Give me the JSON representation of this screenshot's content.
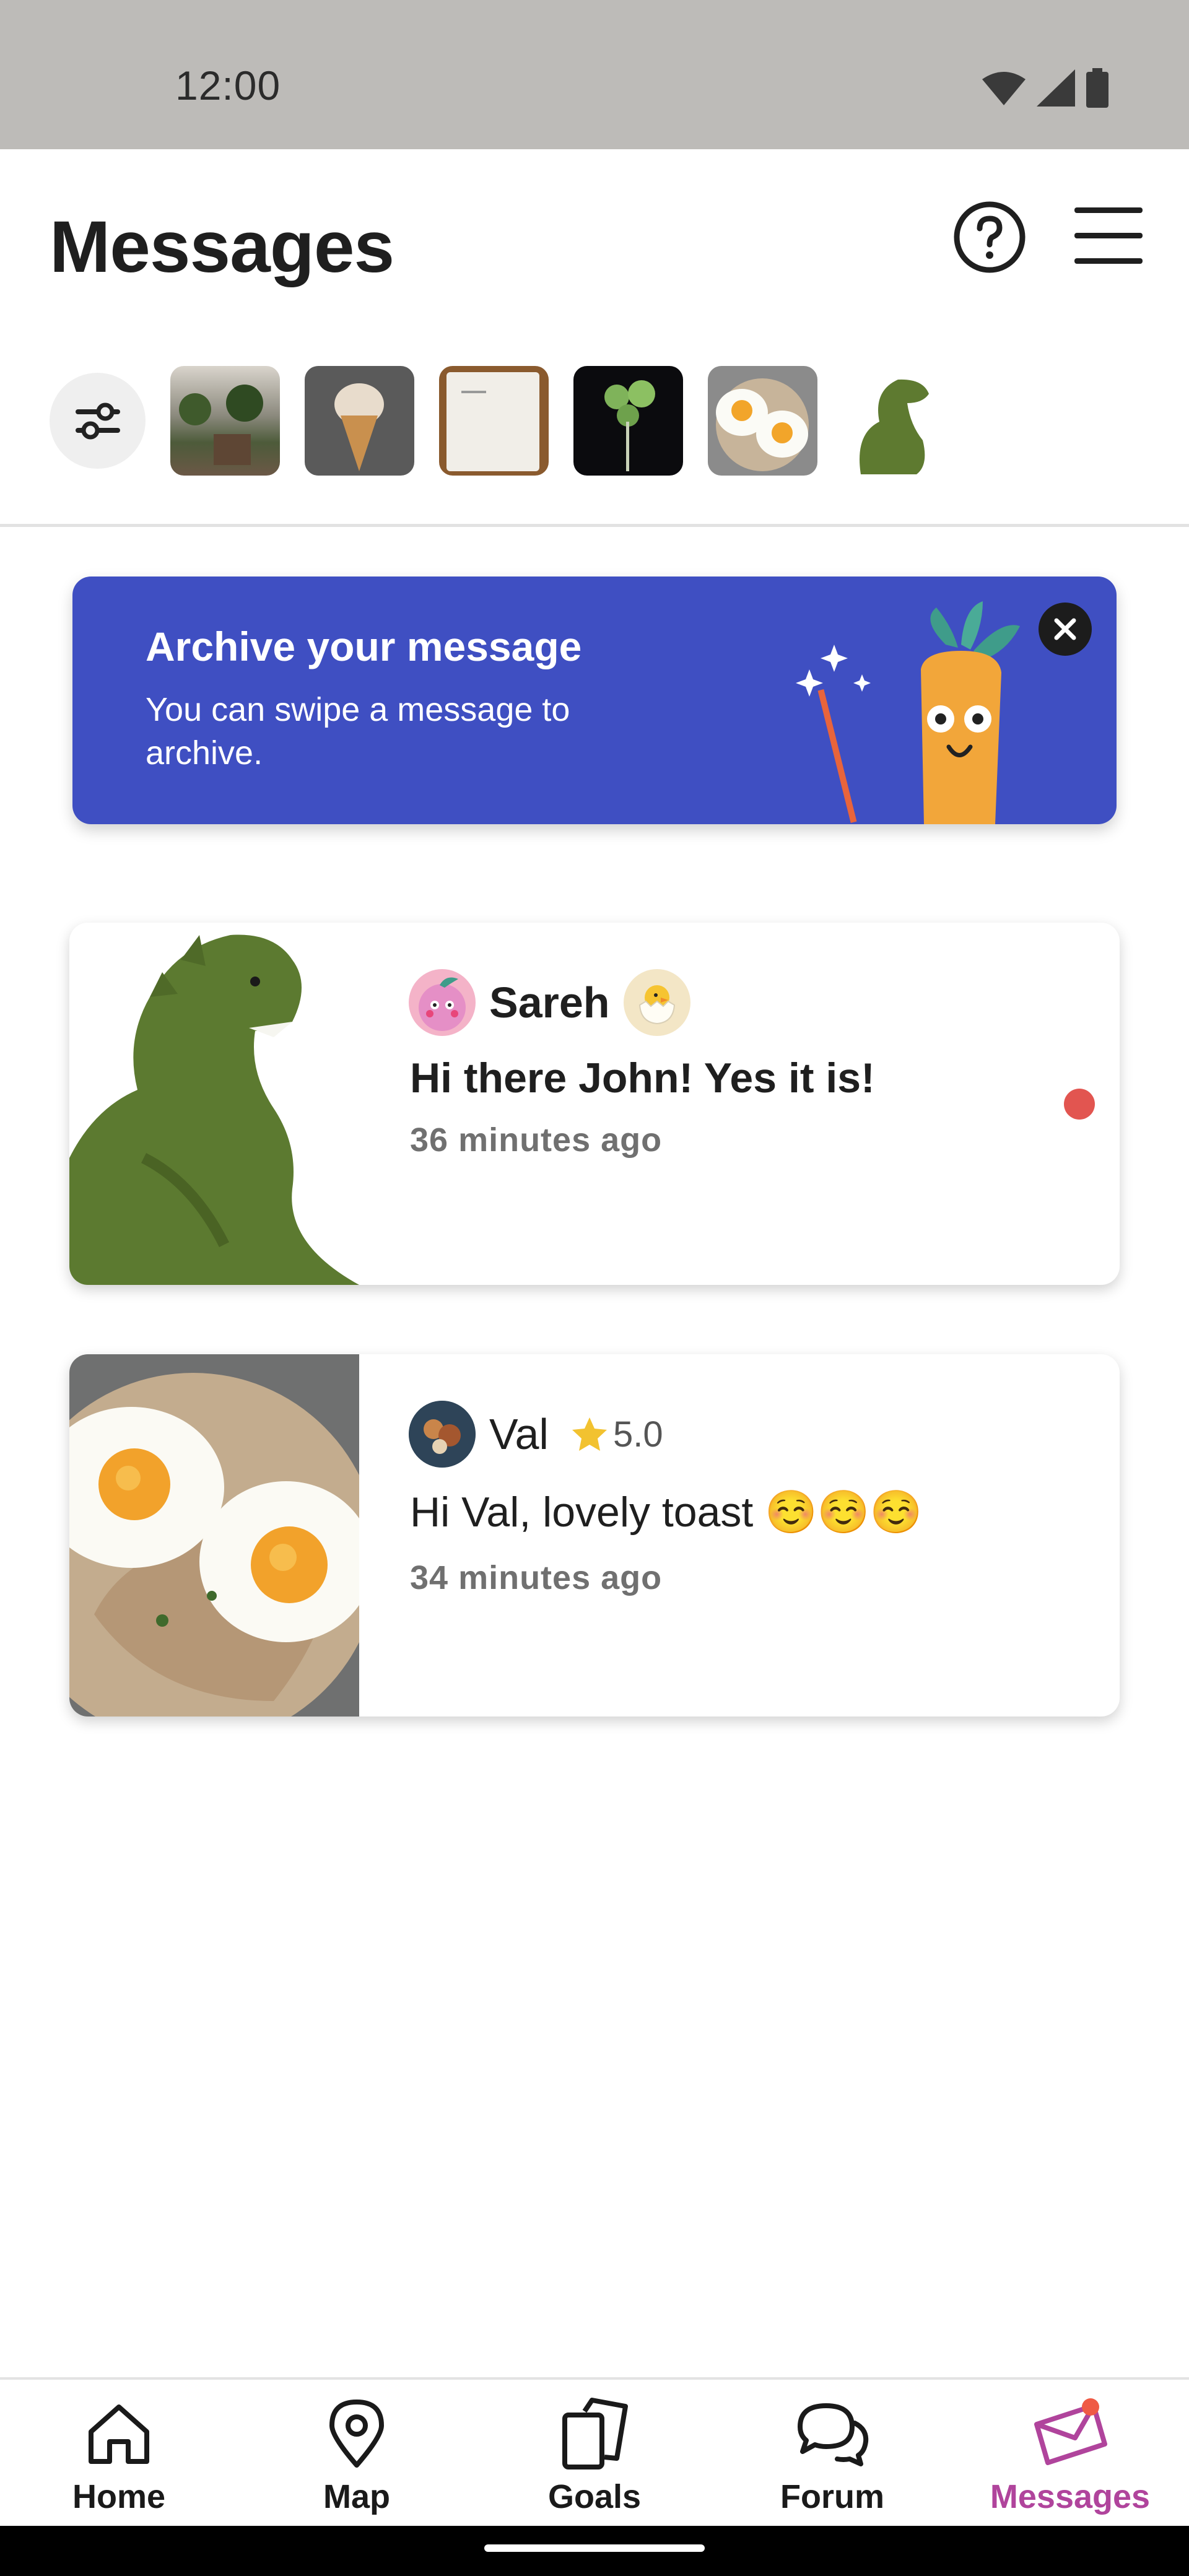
{
  "status_bar": {
    "time": "12:00",
    "icons": [
      "wifi-icon",
      "signal-icon",
      "battery-icon"
    ]
  },
  "header": {
    "title": "Messages",
    "help_icon": "question-circle-icon",
    "menu_icon": "hamburger-menu-icon"
  },
  "filters": {
    "filter_icon": "sliders-icon",
    "thumbnails": [
      "plants-shelf",
      "ice-cream-cone",
      "cable-box",
      "plant-cutting",
      "eggs-on-toast",
      "dinosaur-plush"
    ]
  },
  "banner": {
    "title": "Archive your message",
    "text": "You can swipe a message to archive.",
    "close_icon": "close-icon",
    "background": "#3f4fc2"
  },
  "messages": [
    {
      "sender": "Sareh",
      "text": "Hi there John! Yes it is!",
      "time": "36 minutes ago",
      "unread": true,
      "badge_icon": "hatching-chick-icon"
    },
    {
      "sender": "Val",
      "rating": "5.0",
      "text": "Hi Val, lovely toast ☺️☺️☺️",
      "time": "34 minutes ago",
      "unread": false
    }
  ],
  "bottom_nav": {
    "items": [
      {
        "label": "Home",
        "icon": "home-icon"
      },
      {
        "label": "Map",
        "icon": "map-pin-icon"
      },
      {
        "label": "Goals",
        "icon": "goals-icon"
      },
      {
        "label": "Forum",
        "icon": "chat-bubbles-icon"
      },
      {
        "label": "Messages",
        "icon": "envelope-icon",
        "active": true
      }
    ]
  },
  "colors": {
    "accent": "#b0449c",
    "unread": "#e25550",
    "banner": "#3f4fc2",
    "star": "#f2c230"
  }
}
